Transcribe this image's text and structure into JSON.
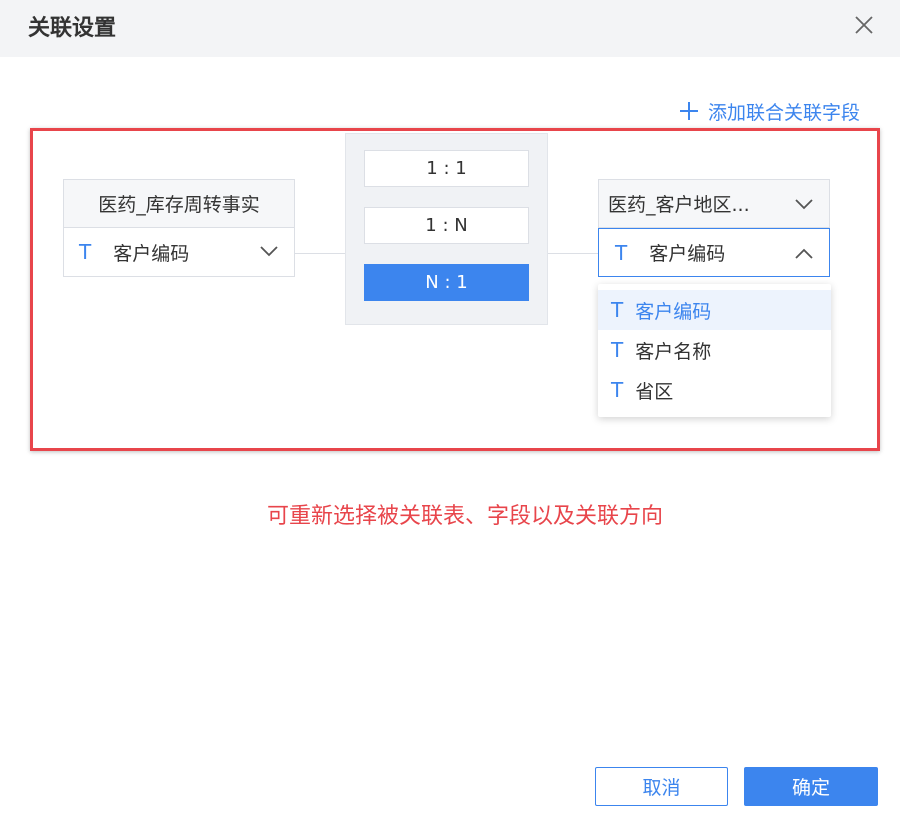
{
  "dialog": {
    "title": "关联设置"
  },
  "add_link": {
    "label": "添加联合关联字段"
  },
  "left_table": {
    "name": "医药_库存周转事实",
    "field_type_icon": "T",
    "field": "客户编码"
  },
  "relations": [
    {
      "label": "1 : 1",
      "selected": false
    },
    {
      "label": "1 : N",
      "selected": false
    },
    {
      "label": "N : 1",
      "selected": true
    }
  ],
  "right_table": {
    "name": "医药_客户地区...",
    "field_type_icon": "T",
    "field": "客户编码"
  },
  "dropdown": {
    "options": [
      {
        "icon": "T",
        "label": "客户编码"
      },
      {
        "icon": "T",
        "label": "客户名称"
      },
      {
        "icon": "T",
        "label": "省区"
      }
    ]
  },
  "annotation": "可重新选择被关联表、字段以及关联方向",
  "footer": {
    "cancel_label": "取消",
    "ok_label": "确定"
  },
  "colors": {
    "accent": "#3c85ee",
    "annotation_red": "#e8454b"
  }
}
